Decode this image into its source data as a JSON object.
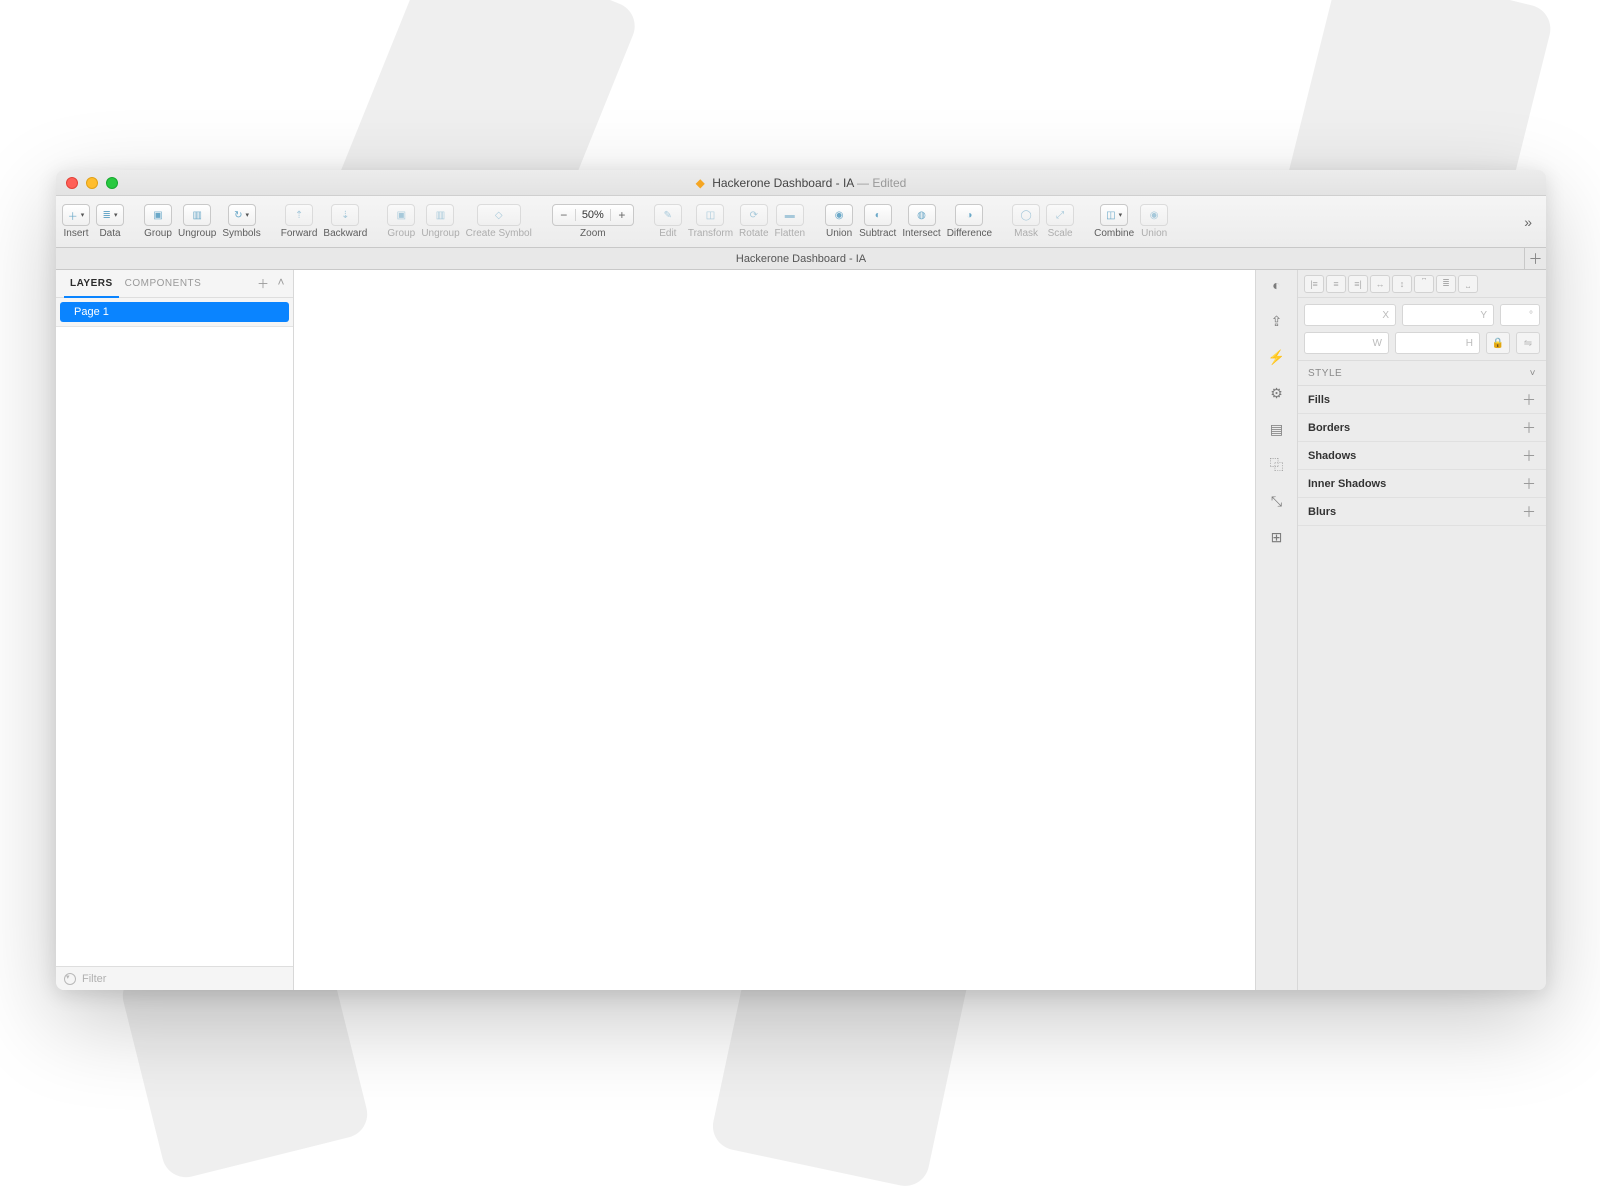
{
  "window": {
    "title": "Hackerone Dashboard - IA",
    "edited_suffix": "— Edited",
    "doc_tab": "Hackerone Dashboard - IA"
  },
  "toolbar": {
    "insert": "Insert",
    "data": "Data",
    "group": "Group",
    "ungroup": "Ungroup",
    "symbols": "Symbols",
    "forward": "Forward",
    "backward": "Backward",
    "group2": "Group",
    "ungroup2": "Ungroup",
    "create_symbol": "Create Symbol",
    "zoom": "Zoom",
    "zoom_value": "50%",
    "edit": "Edit",
    "transform": "Transform",
    "rotate": "Rotate",
    "flatten": "Flatten",
    "union": "Union",
    "subtract": "Subtract",
    "intersect": "Intersect",
    "difference": "Difference",
    "mask": "Mask",
    "scale": "Scale",
    "combine": "Combine",
    "union2": "Union"
  },
  "left_panel": {
    "tab_layers": "LAYERS",
    "tab_components": "COMPONENTS",
    "page1": "Page 1",
    "filter_placeholder": "Filter"
  },
  "inspector": {
    "dims": {
      "x": "X",
      "y": "Y",
      "w": "W",
      "h": "H",
      "angle": "°"
    },
    "style_header": "STYLE",
    "fills": "Fills",
    "borders": "Borders",
    "shadows": "Shadows",
    "inner_shadows": "Inner Shadows",
    "blurs": "Blurs"
  }
}
